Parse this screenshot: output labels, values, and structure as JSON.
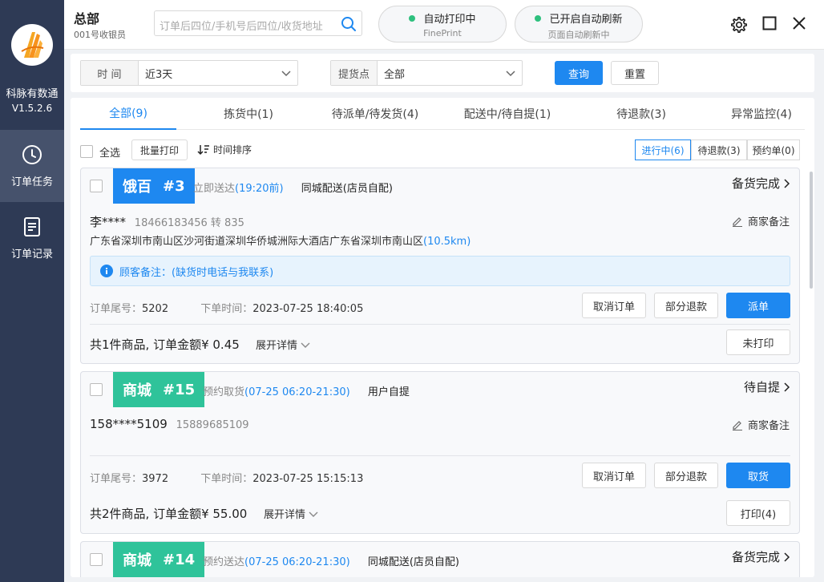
{
  "sidebar": {
    "app_name": "科脉有数通",
    "version": "V1.5.2.6",
    "items": [
      {
        "label": "订单任务",
        "icon": "clock-icon"
      },
      {
        "label": "订单记录",
        "icon": "document-icon"
      }
    ]
  },
  "header": {
    "title": "总部",
    "subtitle": "001号收银员",
    "search_placeholder": "订单后四位/手机号后四位/收货地址",
    "print_status": "自动打印中",
    "print_sub": "FinePrint",
    "refresh_status": "已开启自动刷新",
    "refresh_sub": "页面自动刷新中",
    "status_color": "#2ec07e"
  },
  "filters": {
    "time_label": "时 间",
    "time_value": "近3天",
    "pickup_label": "提货点",
    "pickup_value": "全部",
    "query_label": "查询",
    "reset_label": "重置"
  },
  "tabs": [
    {
      "label": "全部(9)"
    },
    {
      "label": "拣货中(1)"
    },
    {
      "label": "待派单/待发货(4)"
    },
    {
      "label": "配送中/待自提(1)"
    },
    {
      "label": "待退款(3)"
    },
    {
      "label": "异常监控(4)"
    }
  ],
  "toolbar": {
    "select_all": "全选",
    "batch_print": "批量打印",
    "time_sort": "时间排序",
    "seg_in_progress": "进行中(6)",
    "seg_refund": "待退款(3)",
    "seg_reserve": "预约单(0)"
  },
  "orders": [
    {
      "platform": "饿百",
      "number": "#3",
      "badge_color": "#1e88f0",
      "delivery_type": "立即送达",
      "delivery_time": "(19:20前)",
      "delivery_method": "同城配送(店员自配)",
      "status": "备货完成",
      "customer_name": "李****",
      "customer_phone": "18466183456 转 835",
      "merchant_note": "商家备注",
      "address": "广东省深圳市南山区沙河街道深圳华侨城洲际大酒店广东省深圳市南山区",
      "distance": "(10.5km)",
      "customer_note": "顾客备注：(缺货时电话与我联系)",
      "tail_label": "订单尾号：",
      "tail_value": "5202",
      "time_label": "下单时间：",
      "time_value": "2023-07-25 18:40:05",
      "btn_cancel": "取消订单",
      "btn_partial": "部分退款",
      "btn_action": "派单",
      "summary": "共1件商品, 订单金额¥ 0.45",
      "expand": "展开详情",
      "btn_print": "未打印"
    },
    {
      "platform": "商城",
      "number": "#15",
      "badge_color": "#2fc39a",
      "delivery_type": "预约取货",
      "delivery_time": "(07-25 06:20-21:30)",
      "delivery_method": "用户自提",
      "status": "待自提",
      "customer_name": "158****5109",
      "customer_phone": "15889685109",
      "merchant_note": "商家备注",
      "tail_label": "订单尾号：",
      "tail_value": "3972",
      "time_label": "下单时间：",
      "time_value": "2023-07-25 15:15:13",
      "btn_cancel": "取消订单",
      "btn_partial": "部分退款",
      "btn_action": "取货",
      "summary": "共2件商品, 订单金额¥ 55.00",
      "expand": "展开详情",
      "btn_print": "打印(4)"
    },
    {
      "platform": "商城",
      "number": "#14",
      "badge_color": "#2fc39a",
      "delivery_type": "预约送达",
      "delivery_time": "(07-25 06:20-21:30)",
      "delivery_method": "同城配送(店员自配)",
      "status": "备货完成"
    }
  ]
}
